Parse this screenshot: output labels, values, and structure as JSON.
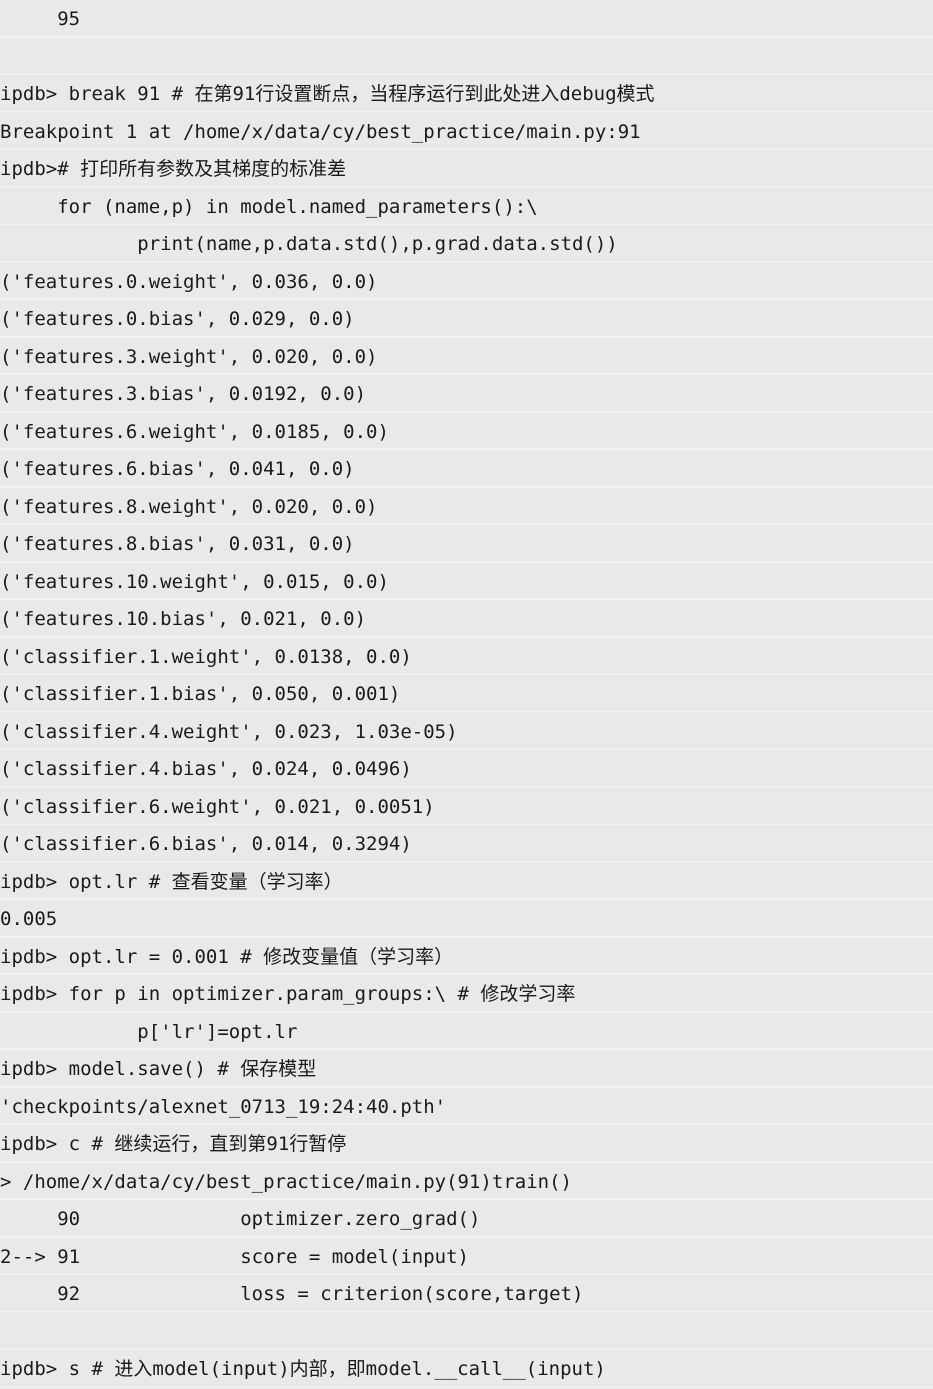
{
  "terminal": {
    "lines": [
      "     95",
      "",
      "ipdb> break 91 # 在第91行设置断点，当程序运行到此处进入debug模式",
      "Breakpoint 1 at /home/x/data/cy/best_practice/main.py:91",
      "ipdb># 打印所有参数及其梯度的标准差",
      "     for (name,p) in model.named_parameters():\\",
      "            print(name,p.data.std(),p.grad.data.std())",
      "('features.0.weight', 0.036, 0.0)",
      "('features.0.bias', 0.029, 0.0)",
      "('features.3.weight', 0.020, 0.0)",
      "('features.3.bias', 0.0192, 0.0)",
      "('features.6.weight', 0.0185, 0.0)",
      "('features.6.bias', 0.041, 0.0)",
      "('features.8.weight', 0.020, 0.0)",
      "('features.8.bias', 0.031, 0.0)",
      "('features.10.weight', 0.015, 0.0)",
      "('features.10.bias', 0.021, 0.0)",
      "('classifier.1.weight', 0.0138, 0.0)",
      "('classifier.1.bias', 0.050, 0.001)",
      "('classifier.4.weight', 0.023, 1.03e-05)",
      "('classifier.4.bias', 0.024, 0.0496)",
      "('classifier.6.weight', 0.021, 0.0051)",
      "('classifier.6.bias', 0.014, 0.3294)",
      "ipdb> opt.lr # 查看变量（学习率）",
      "0.005",
      "ipdb> opt.lr = 0.001 # 修改变量值（学习率）",
      "ipdb> for p in optimizer.param_groups:\\ # 修改学习率",
      "            p['lr']=opt.lr",
      "ipdb> model.save() # 保存模型",
      "'checkpoints/alexnet_0713_19:24:40.pth'",
      "ipdb> c # 继续运行，直到第91行暂停",
      "> /home/x/data/cy/best_practice/main.py(91)train()",
      "     90              optimizer.zero_grad()",
      "2--> 91              score = model(input)",
      "     92              loss = criterion(score,target)",
      "",
      "ipdb> s # 进入model(input)内部，即model.__call__(input)"
    ]
  }
}
